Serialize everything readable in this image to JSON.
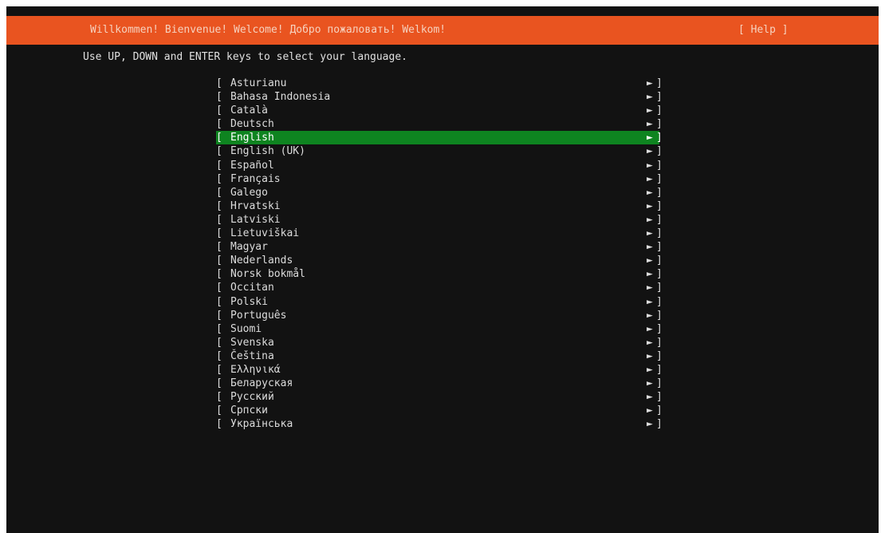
{
  "header": {
    "welcome": "Willkommen! Bienvenue! Welcome! Добро пожаловать! Welkom!",
    "help": "[ Help ]"
  },
  "instructions": "Use UP, DOWN and ENTER keys to select your language.",
  "bracket_open": "[",
  "bracket_close": "]",
  "arrow_glyph": "►",
  "colors": {
    "background": "#121212",
    "header": "#e95420",
    "selection": "#0e8420",
    "text": "#dcdcdc"
  },
  "languages": [
    {
      "label": "Asturianu"
    },
    {
      "label": "Bahasa Indonesia"
    },
    {
      "label": "Català"
    },
    {
      "label": "Deutsch"
    },
    {
      "label": "English",
      "selected": true
    },
    {
      "label": "English (UK)"
    },
    {
      "label": "Español"
    },
    {
      "label": "Français"
    },
    {
      "label": "Galego"
    },
    {
      "label": "Hrvatski"
    },
    {
      "label": "Latviski"
    },
    {
      "label": "Lietuviškai"
    },
    {
      "label": "Magyar"
    },
    {
      "label": "Nederlands"
    },
    {
      "label": "Norsk bokmål"
    },
    {
      "label": "Occitan"
    },
    {
      "label": "Polski"
    },
    {
      "label": "Português"
    },
    {
      "label": "Suomi"
    },
    {
      "label": "Svenska"
    },
    {
      "label": "Čeština"
    },
    {
      "label": "Ελληνικά"
    },
    {
      "label": "Беларуская"
    },
    {
      "label": "Русский"
    },
    {
      "label": "Српски"
    },
    {
      "label": "Українська"
    }
  ]
}
